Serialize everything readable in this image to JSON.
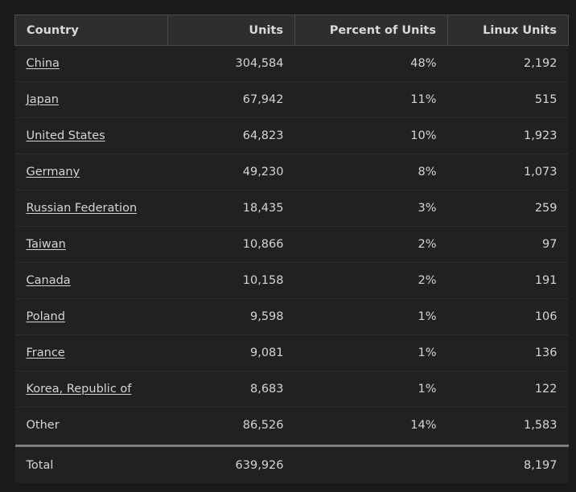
{
  "table": {
    "columns": [
      {
        "key": "country",
        "label": "Country",
        "align": "left"
      },
      {
        "key": "units",
        "label": "Units",
        "align": "right"
      },
      {
        "key": "percent",
        "label": "Percent of Units",
        "align": "right"
      },
      {
        "key": "linux_units",
        "label": "Linux Units",
        "align": "right"
      }
    ],
    "rows": [
      {
        "country": "China",
        "is_link": true,
        "units": "304,584",
        "percent": "48%",
        "linux_units": "2,192"
      },
      {
        "country": "Japan",
        "is_link": true,
        "units": "67,942",
        "percent": "11%",
        "linux_units": "515"
      },
      {
        "country": "United States",
        "is_link": true,
        "units": "64,823",
        "percent": "10%",
        "linux_units": "1,923"
      },
      {
        "country": "Germany",
        "is_link": true,
        "units": "49,230",
        "percent": "8%",
        "linux_units": "1,073"
      },
      {
        "country": "Russian Federation",
        "is_link": true,
        "units": "18,435",
        "percent": "3%",
        "linux_units": "259"
      },
      {
        "country": "Taiwan",
        "is_link": true,
        "units": "10,866",
        "percent": "2%",
        "linux_units": "97"
      },
      {
        "country": "Canada",
        "is_link": true,
        "units": "10,158",
        "percent": "2%",
        "linux_units": "191"
      },
      {
        "country": "Poland",
        "is_link": true,
        "units": "9,598",
        "percent": "1%",
        "linux_units": "106"
      },
      {
        "country": "France",
        "is_link": true,
        "units": "9,081",
        "percent": "1%",
        "linux_units": "136"
      },
      {
        "country": "Korea, Republic of",
        "is_link": true,
        "units": "8,683",
        "percent": "1%",
        "linux_units": "122"
      },
      {
        "country": "Other",
        "is_link": false,
        "units": "86,526",
        "percent": "14%",
        "linux_units": "1,583"
      }
    ],
    "total": {
      "country": "Total",
      "units": "639,926",
      "percent": "",
      "linux_units": "8,197"
    }
  },
  "colors": {
    "page_background": "#1a1a1a",
    "header_background": "#2e2e2e",
    "row_background": "#212121",
    "text": "#d5d5d5",
    "border": "#4a4a4a",
    "row_divider": "#2f2f2f",
    "total_rule": "#7d7d7d"
  }
}
